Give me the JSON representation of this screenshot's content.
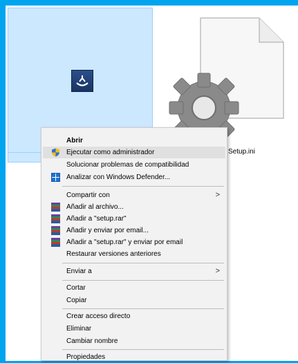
{
  "files": {
    "setup_ini_name": "Setup.ini"
  },
  "menu": {
    "items": [
      {
        "label": "Abrir"
      },
      {
        "label": "Ejecutar como administrador"
      },
      {
        "label": "Solucionar problemas de compatibilidad"
      },
      {
        "label": "Analizar con Windows Defender..."
      },
      {
        "label": "Compartir con"
      },
      {
        "label": "Añadir al archivo..."
      },
      {
        "label": "Añadir a \"setup.rar\""
      },
      {
        "label": "Añadir y enviar por email..."
      },
      {
        "label": "Añadir a \"setup.rar\" y enviar por email"
      },
      {
        "label": "Restaurar versiones anteriores"
      },
      {
        "label": "Enviar a"
      },
      {
        "label": "Cortar"
      },
      {
        "label": "Copiar"
      },
      {
        "label": "Crear acceso directo"
      },
      {
        "label": "Eliminar"
      },
      {
        "label": "Cambiar nombre"
      },
      {
        "label": "Propiedades"
      }
    ],
    "submenu_arrow": ">"
  },
  "icons": {
    "run_as_admin": "uac-shield-icon",
    "defender": "windows-defender-icon",
    "winrar": "winrar-icon",
    "setup": "setup-installer-icon",
    "ini_file": "ini-settings-file-icon"
  },
  "colors": {
    "desktop_background": "#00A4EF",
    "selection_fill": "#CCE8FF",
    "selection_border": "#99D1FF",
    "menu_background": "#F2F2F2",
    "menu_highlight": "#E0E0E0"
  }
}
